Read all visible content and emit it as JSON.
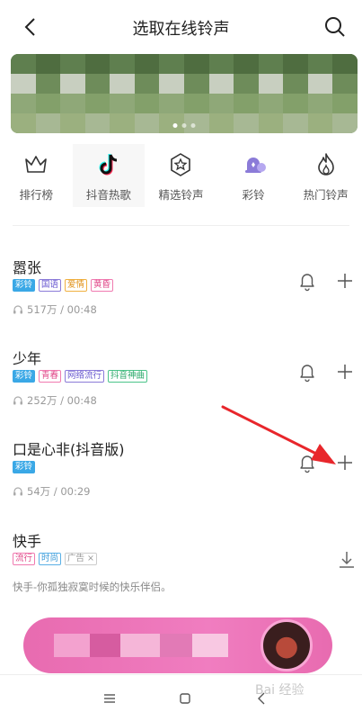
{
  "header": {
    "title": "选取在线铃声"
  },
  "categories": [
    {
      "label": "排行榜",
      "icon": "crown-icon"
    },
    {
      "label": "抖音热歌",
      "icon": "tiktok-icon"
    },
    {
      "label": "精选铃声",
      "icon": "star-badge-icon"
    },
    {
      "label": "彩铃",
      "icon": "color-ringtone-icon"
    },
    {
      "label": "热门铃声",
      "icon": "flame-icon"
    }
  ],
  "songs": [
    {
      "title": "嚣张",
      "tags": [
        "彩铃",
        "国语",
        "爱情",
        "黄昏"
      ],
      "plays": "517万",
      "duration": "00:48",
      "meta": "517万 / 00:48"
    },
    {
      "title": "少年",
      "tags": [
        "彩铃",
        "青春",
        "网络流行",
        "抖音神曲"
      ],
      "plays": "252万",
      "duration": "00:48",
      "meta": "252万 / 00:48"
    },
    {
      "title": "口是心非(抖音版)",
      "tags": [
        "彩铃"
      ],
      "plays": "54万",
      "duration": "00:29",
      "meta": "54万 / 00:29"
    }
  ],
  "ad": {
    "title": "快手",
    "tags": [
      "流行",
      "时尚",
      "广告 ×"
    ],
    "description": "快手-你孤独寂寞时候的快乐伴侣。"
  },
  "watermark": "Bai 经验",
  "colors": {
    "tag_fill": "#3aa8e6",
    "accent_purple": "#8b7bd8",
    "arrow_red": "#e8262b",
    "promo_pink": "#e86bb0"
  }
}
